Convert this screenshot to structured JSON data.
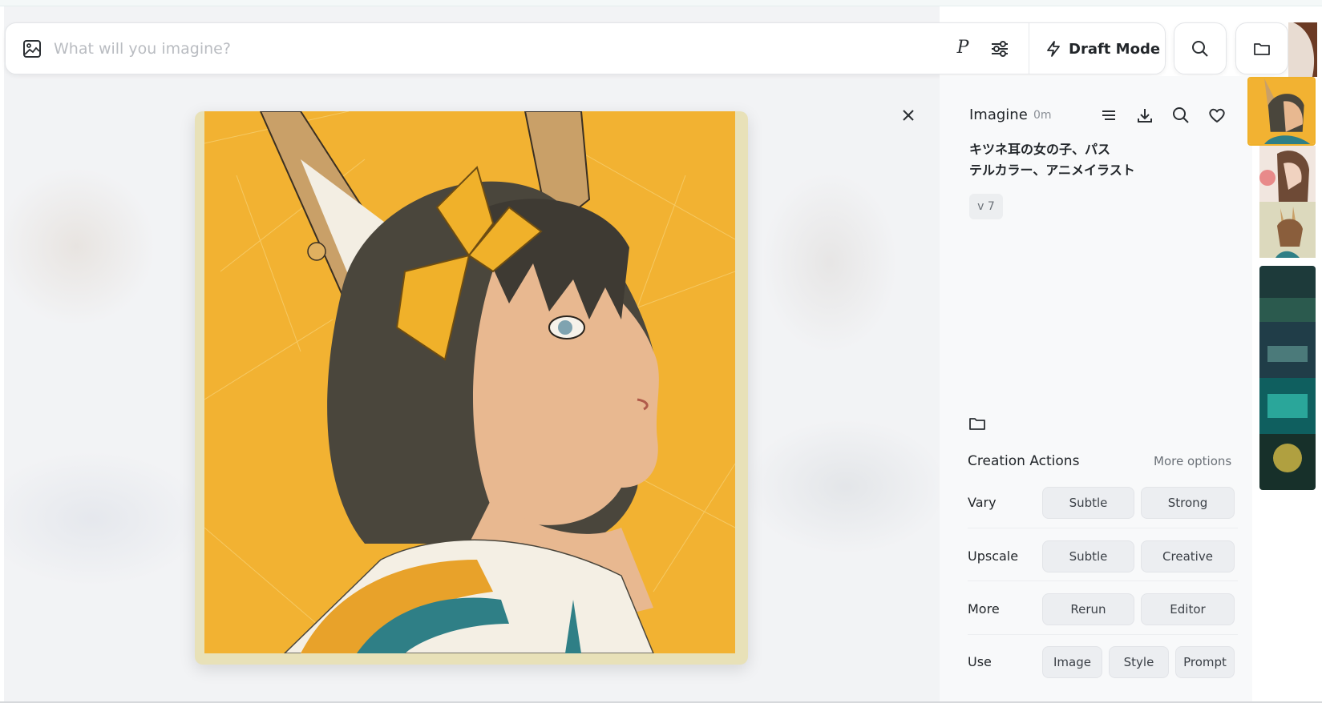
{
  "search": {
    "placeholder": "What will you imagine?",
    "personalize_label": "P",
    "draft_mode_label": "Draft Mode"
  },
  "details": {
    "title": "Imagine",
    "time": "0m",
    "prompt_lines": [
      "キツネ耳の女の子、パス",
      "テルカラー、アニメイラスト"
    ],
    "version": "v 7",
    "creation_actions_title": "Creation Actions",
    "more_options_label": "More options",
    "rows": {
      "vary": {
        "label": "Vary",
        "buttons": [
          "Subtle",
          "Strong"
        ]
      },
      "upscale": {
        "label": "Upscale",
        "buttons": [
          "Subtle",
          "Creative"
        ]
      },
      "more": {
        "label": "More",
        "buttons": [
          "Rerun",
          "Editor"
        ]
      },
      "use": {
        "label": "Use",
        "buttons": [
          "Image",
          "Style",
          "Prompt"
        ]
      }
    }
  },
  "colors": {
    "art_background": "#f2b232",
    "ribbon": "#f0b12a",
    "frame": "#e8e1b8"
  },
  "icons": {
    "search_bar": "image-icon",
    "settings": "sliders-icon",
    "draft": "lightning-icon",
    "search": "search-icon",
    "folder": "folder-icon",
    "close": "close-icon",
    "filter": "lines-icon",
    "download": "download-icon",
    "favorite": "heart-icon"
  }
}
